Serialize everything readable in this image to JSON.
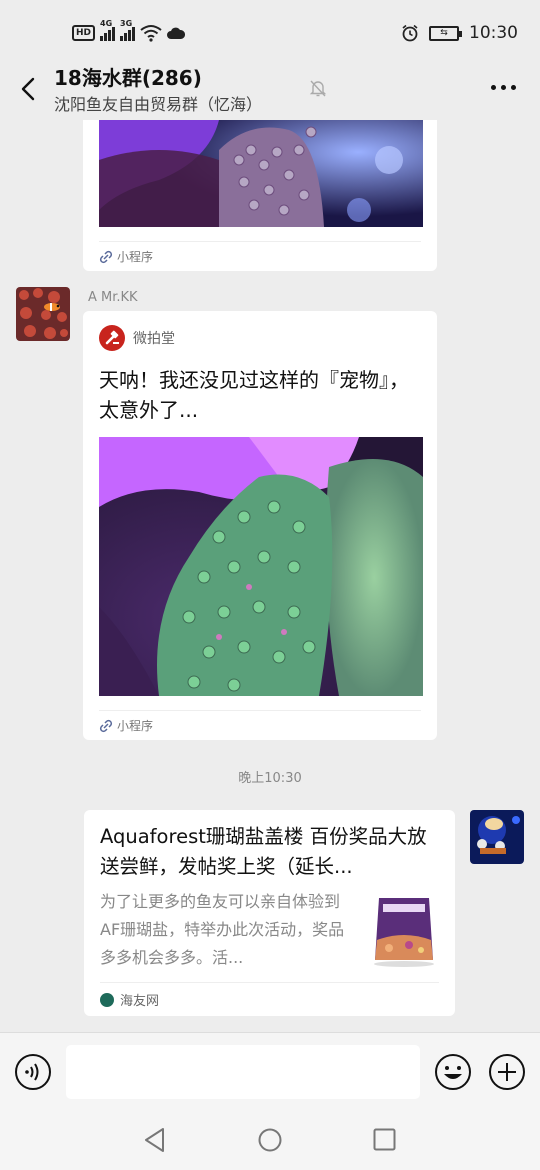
{
  "status": {
    "time": "10:30",
    "hd": "HD",
    "net1": "4G",
    "net2": "3G"
  },
  "header": {
    "title": "18海水群(286)",
    "subtitle": "沈阳鱼友自由贸易群（忆海）"
  },
  "messages": {
    "top_card": {
      "footer": "小程序"
    },
    "mini_program": {
      "sender": "A  Mr.KK",
      "source": "微拍堂",
      "title": "天呐！我还没见过这样的『宠物』，太意外了...",
      "footer": "小程序"
    },
    "timestamp": "晚上10:30",
    "article": {
      "title": "Aquaforest珊瑚盐盖楼 百份奖品大放送尝鲜，发帖奖上奖（延长...",
      "desc": "为了让更多的鱼友可以亲自体验到AF珊瑚盐，特举办此次活动，奖品多多机会多多。活...",
      "site": "海友网"
    }
  },
  "colors": {
    "bg": "#ededed",
    "card": "#ffffff",
    "brand_red": "#c8241d"
  }
}
